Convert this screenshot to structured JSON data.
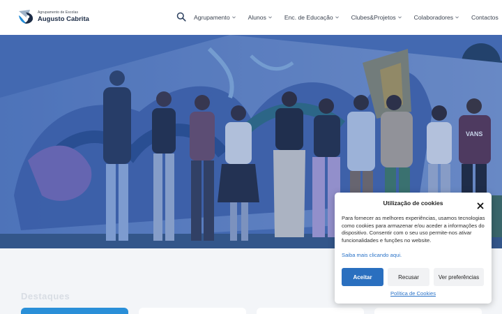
{
  "header": {
    "logo": {
      "subtitle": "Agrupamento de Escolas",
      "name": "Augusto Cabrita"
    },
    "search_icon": "search-icon",
    "nav": [
      {
        "label": "Agrupamento",
        "has_dropdown": true
      },
      {
        "label": "Alunos",
        "has_dropdown": true
      },
      {
        "label": "Enc. de Educação",
        "has_dropdown": true
      },
      {
        "label": "Clubes&Projetos",
        "has_dropdown": true
      },
      {
        "label": "Colaboradores",
        "has_dropdown": true
      },
      {
        "label": "Contactos",
        "has_dropdown": false
      }
    ]
  },
  "hero": {
    "overlay_color": "#2f5aa8",
    "shirt_text": "VANS"
  },
  "section": {
    "title": "Destaques"
  },
  "cookie_dialog": {
    "title": "Utilização de cookies",
    "body": "Para fornecer as melhores experiências, usamos tecnologias como cookies para armazenar e/ou aceder a informações do dispositivo. Consentir com o seu uso permite-nos ativar funcionalidades e funções no website.",
    "more_link": "Saiba mais clicando aqui.",
    "accept_label": "Aceitar",
    "reject_label": "Recusar",
    "prefs_label": "Ver preferências",
    "policy_link": "Política de Cookies"
  },
  "colors": {
    "accent": "#2a6fbf",
    "brand_dark": "#1c2c46",
    "card_blue": "#2a8fd8"
  }
}
